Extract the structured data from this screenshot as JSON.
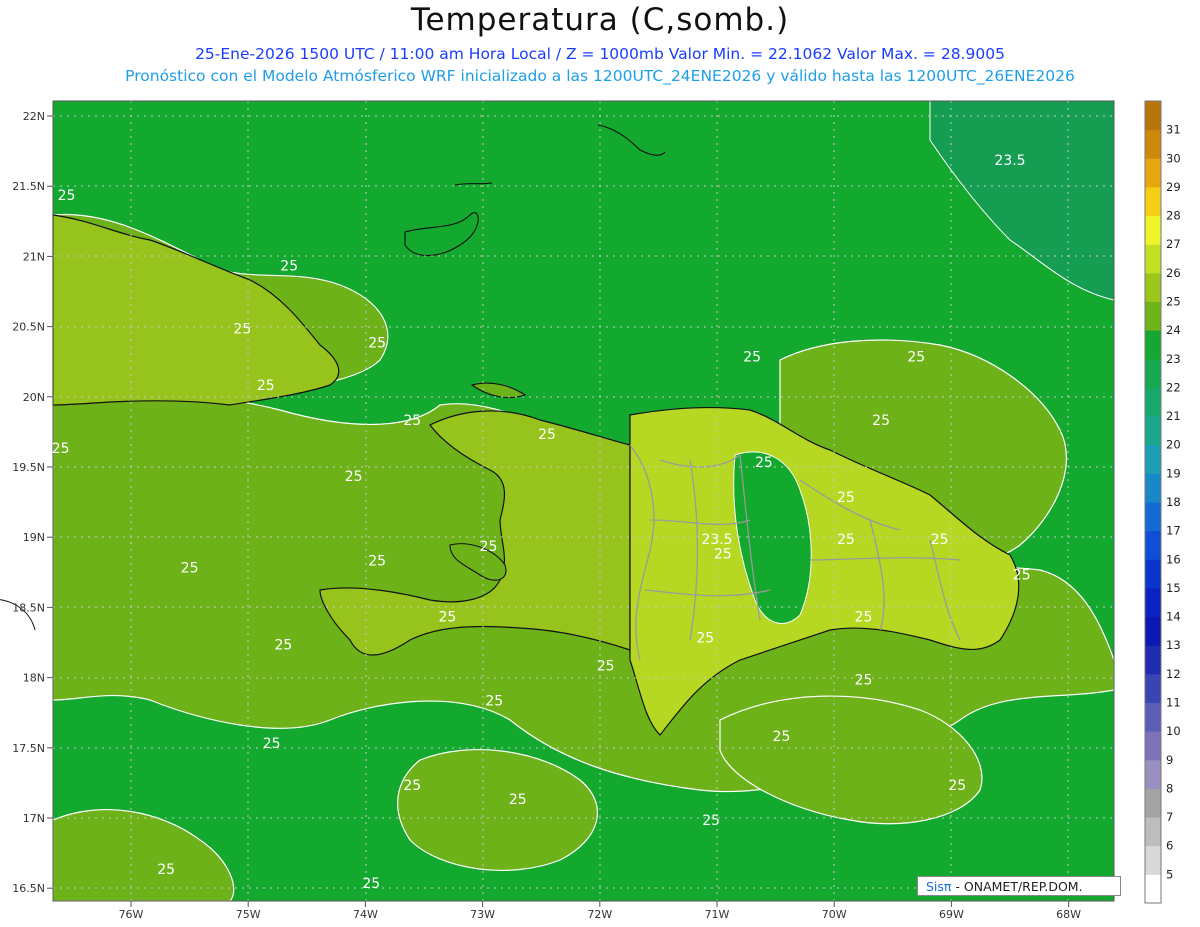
{
  "header": {
    "title": "Temperatura (C,somb.)",
    "line1": "25-Ene-2026 1500 UTC / 11:00 am Hora Local / Z = 1000mb  Valor Min. = 22.1062  Valor Max. = 28.9005",
    "line2": "Pronóstico con el Modelo Atmósferico WRF inicializado a las 1200UTC_24ENE2026 y válido hasta las  1200UTC_26ENE2026"
  },
  "axes": {
    "lat_labels": [
      "22N",
      "21.5N",
      "21N",
      "20.5N",
      "20N",
      "19.5N",
      "19N",
      "18.5N",
      "18N",
      "17.5N",
      "17N",
      "16.5N"
    ],
    "lon_labels": [
      "76W",
      "75W",
      "74W",
      "73W",
      "72W",
      "71W",
      "70W",
      "69W",
      "68W"
    ]
  },
  "contour_labels": [
    {
      "text": "25",
      "lon": -76.55,
      "lat": 21.4
    },
    {
      "text": "25",
      "lon": -74.65,
      "lat": 20.9
    },
    {
      "text": "25",
      "lon": -75.05,
      "lat": 20.45
    },
    {
      "text": "25",
      "lon": -73.9,
      "lat": 20.35
    },
    {
      "text": "25",
      "lon": -74.85,
      "lat": 20.05
    },
    {
      "text": "25",
      "lon": -76.6,
      "lat": 19.6
    },
    {
      "text": "25",
      "lon": -73.6,
      "lat": 19.8
    },
    {
      "text": "25",
      "lon": -72.45,
      "lat": 19.7
    },
    {
      "text": "25",
      "lon": -74.1,
      "lat": 19.4
    },
    {
      "text": "25",
      "lon": -72.95,
      "lat": 18.9
    },
    {
      "text": "25",
      "lon": -75.5,
      "lat": 18.75
    },
    {
      "text": "25",
      "lon": -73.9,
      "lat": 18.8
    },
    {
      "text": "25",
      "lon": -73.3,
      "lat": 18.4
    },
    {
      "text": "25",
      "lon": -74.7,
      "lat": 18.2
    },
    {
      "text": "25",
      "lon": -71.95,
      "lat": 18.05
    },
    {
      "text": "25",
      "lon": -71.1,
      "lat": 18.25
    },
    {
      "text": "25",
      "lon": -72.9,
      "lat": 17.8
    },
    {
      "text": "25",
      "lon": -74.8,
      "lat": 17.5
    },
    {
      "text": "25",
      "lon": -73.6,
      "lat": 17.2
    },
    {
      "text": "25",
      "lon": -72.7,
      "lat": 17.1
    },
    {
      "text": "25",
      "lon": -70.7,
      "lat": 20.25
    },
    {
      "text": "25",
      "lon": -69.3,
      "lat": 20.25
    },
    {
      "text": "25",
      "lon": -69.6,
      "lat": 19.8
    },
    {
      "text": "25",
      "lon": -70.6,
      "lat": 19.5
    },
    {
      "text": "25",
      "lon": -69.9,
      "lat": 19.25
    },
    {
      "text": "25",
      "lon": -69.9,
      "lat": 18.95
    },
    {
      "text": "25",
      "lon": -69.1,
      "lat": 18.95
    },
    {
      "text": "25",
      "lon": -70.95,
      "lat": 18.85
    },
    {
      "text": "25",
      "lon": -68.4,
      "lat": 18.7
    },
    {
      "text": "25",
      "lon": -69.75,
      "lat": 18.4
    },
    {
      "text": "25",
      "lon": -69.75,
      "lat": 17.95
    },
    {
      "text": "25",
      "lon": -70.45,
      "lat": 17.55
    },
    {
      "text": "25",
      "lon": -68.95,
      "lat": 17.2
    },
    {
      "text": "25",
      "lon": -71.05,
      "lat": 16.95
    },
    {
      "text": "25",
      "lon": -75.7,
      "lat": 16.6
    },
    {
      "text": "25",
      "lon": -73.95,
      "lat": 16.5
    },
    {
      "text": "23.5",
      "lon": -71.0,
      "lat": 18.95
    },
    {
      "text": "23.5",
      "lon": -68.5,
      "lat": 21.65
    }
  ],
  "legend": {
    "labels": [
      "5",
      "6",
      "7",
      "8",
      "9",
      "10",
      "11",
      "12",
      "13",
      "14",
      "15",
      "16",
      "17",
      "18",
      "19",
      "20",
      "21",
      "22",
      "23",
      "24",
      "25",
      "26",
      "27",
      "28",
      "29",
      "30",
      "31"
    ],
    "colors": [
      "#ffffff",
      "#d9d9d9",
      "#bdbdbd",
      "#a3a3a3",
      "#9b8fbf",
      "#7f73b8",
      "#5a5fb5",
      "#3a44b2",
      "#1f2bb0",
      "#0d18b3",
      "#0a22c2",
      "#0b34cc",
      "#0f4fd6",
      "#146bd3",
      "#1988c9",
      "#1c9fb3",
      "#1aa88e",
      "#17a86c",
      "#15a84f",
      "#14a833",
      "#6fb51a",
      "#9bc61c",
      "#c1df23",
      "#eef52a",
      "#f5cf16",
      "#e8a610",
      "#cd8a0a",
      "#b87509"
    ]
  },
  "colors": {
    "field_24": "#13a82e",
    "field_25": "#6eb21a",
    "field_26": "#96c41c",
    "field_27": "#b6d823",
    "field_23": "#159e52",
    "coast": "#111111",
    "province_border": "#9a9a9a",
    "contour": "#ffffff"
  },
  "footer": {
    "credit_prefix": "Sisπ",
    "credit_suffix": " - ONAMET/REP.DOM."
  }
}
